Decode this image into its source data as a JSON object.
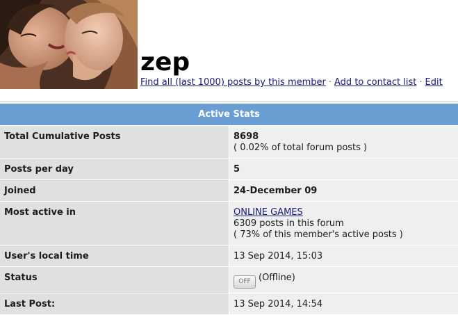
{
  "profile": {
    "username": "zep",
    "actions": [
      "Find all (last 1000) posts by this member",
      "Add to contact list",
      "Edit"
    ]
  },
  "stats": {
    "title": "Active Stats",
    "total_posts": {
      "label": "Total Cumulative Posts",
      "value": "8698",
      "note": "( 0.02% of total forum posts )"
    },
    "posts_per_day": {
      "label": "Posts per day",
      "value": "5"
    },
    "joined": {
      "label": "Joined",
      "value": "24-December 09"
    },
    "most_active": {
      "label": "Most active in",
      "forum": "ONLINE GAMES",
      "posts_line": "6309 posts in this forum",
      "percent_line": "( 73% of this member's active posts )"
    },
    "local_time": {
      "label": "User's local time",
      "value": "13 Sep 2014, 15:03"
    },
    "status": {
      "label": "Status",
      "badge": "OFF",
      "text": "(Offline)"
    },
    "last_post": {
      "label": "Last Post:",
      "value": "13 Sep 2014, 14:54"
    }
  },
  "colors": {
    "header_bar": "#6a9ed3",
    "label_cell": "#dfe1e0",
    "value_cell": "#eeefee",
    "link": "#1a1a7a"
  }
}
